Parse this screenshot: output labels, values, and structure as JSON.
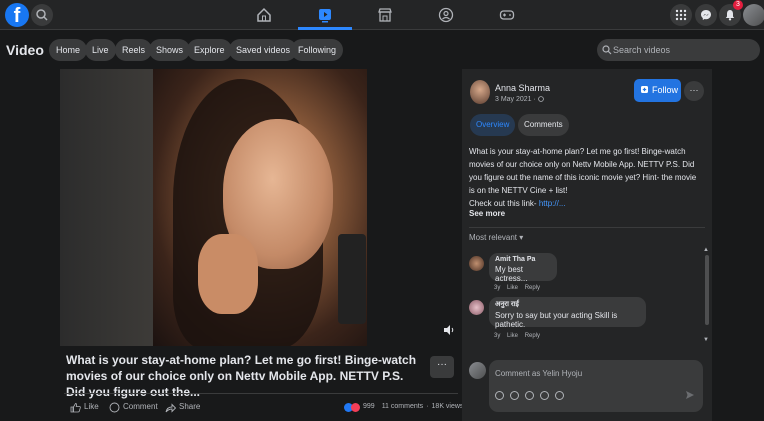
{
  "topbar": {
    "logo": "f",
    "notifications_count": "3",
    "active_tab": "watch",
    "nav": [
      "home-icon",
      "watch-icon",
      "marketplace-icon",
      "groups-icon",
      "gaming-icon"
    ]
  },
  "subbar": {
    "title": "Video",
    "pills": [
      "Home",
      "Live",
      "Reels",
      "Shows",
      "Explore",
      "Saved videos",
      "Following"
    ],
    "search_placeholder": "Search videos"
  },
  "video": {
    "title": "What is your stay-at-home plan? Let me go first! Binge-watch movies of our choice only on Nettv Mobile App. NETTV P.S. Did you figure out the...",
    "more": "···",
    "actions": {
      "like": "Like",
      "comment": "Comment",
      "share": "Share"
    },
    "stats": {
      "reactions": "999",
      "comments": "11 comments",
      "views": "18K views"
    }
  },
  "post": {
    "author": "Anna Sharma",
    "date": "3 May 2021 ·",
    "follow_label": "Follow",
    "more": "···",
    "tabs": [
      "Overview",
      "Comments"
    ],
    "description": "What is your stay-at-home plan? Let me go first! Binge-watch movies of our choice only on Nettv Mobile App. NETTV P.S. Did you figure out the name of this iconic movie yet? Hint- the movie is on the NETTV Cine + list!",
    "link_prefix": "Check out this link- ",
    "link_text": "http://...",
    "see_more": "See more",
    "sort_label": "Most relevant ▾"
  },
  "comments": [
    {
      "name": "Amit Tha Pa",
      "text": "My best actress...",
      "time": "3y",
      "like": "Like",
      "reply": "Reply"
    },
    {
      "name": "अनुरा राई",
      "text": "Sorry to say but your acting Skill is pathetic.",
      "time": "3y",
      "like": "Like",
      "reply": "Reply"
    }
  ],
  "composer": {
    "placeholder": "Comment as Yelin Hyoju"
  },
  "colors": {
    "accent": "#2374e1",
    "background": "#18191a",
    "panel": "#242526",
    "link": "#4599ff"
  }
}
